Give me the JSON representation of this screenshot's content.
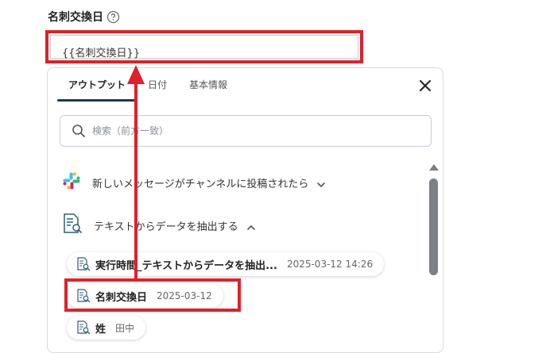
{
  "field": {
    "label": "名刺交換日",
    "value": "{{名刺交換日}}"
  },
  "tabs": [
    {
      "label": "アウトプット",
      "active": true
    },
    {
      "label": "日付",
      "active": false
    },
    {
      "label": "基本情報",
      "active": false
    }
  ],
  "search": {
    "placeholder": "検索（前方一致）"
  },
  "groups": [
    {
      "label": "新しいメッセージがチャンネルに投稿されたら",
      "expanded": false,
      "icon": "slack-icon"
    },
    {
      "label": "テキストからデータを抽出する",
      "expanded": true,
      "icon": "document-search-icon"
    }
  ],
  "items": [
    {
      "name": "実行時間_テキストからデータを抽出...",
      "value": "2025-03-12 14:26"
    },
    {
      "name": "名刺交換日",
      "value": "2025-03-12"
    },
    {
      "name": "姓",
      "value": "田中"
    }
  ],
  "colors": {
    "highlight": "#e0202a",
    "tab_indicator": "#1e3a4a"
  }
}
